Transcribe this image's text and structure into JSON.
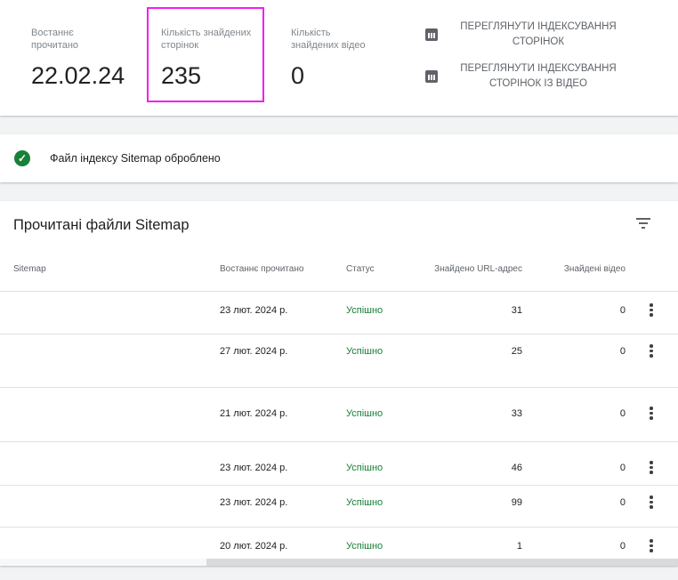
{
  "stats": [
    {
      "label": "Востаннє прочитано",
      "value": "22.02.24"
    },
    {
      "label": "Кількість знайдених сторінок",
      "value": "235"
    },
    {
      "label": "Кількість знайдених відео",
      "value": "0"
    }
  ],
  "links": [
    "ПЕРЕГЛЯНУТИ ІНДЕКСУВАННЯ СТОРІНОК",
    "ПЕРЕГЛЯНУТИ ІНДЕКСУВАННЯ СТОРІНОК ІЗ ВІДЕО"
  ],
  "status": "Файл індексу Sitemap оброблено",
  "table": {
    "title": "Прочитані файли Sitemap",
    "headers": [
      "Sitemap",
      "Востаннє прочитано",
      "Статус",
      "Знайдено URL-адрес",
      "Знайдені відео"
    ],
    "rows": [
      {
        "sitemap": "",
        "date": "23 лют. 2024 р.",
        "status": "Успішно",
        "urls": "31",
        "videos": "0"
      },
      {
        "sitemap": "",
        "date": "27 лют. 2024 р.",
        "status": "Успішно",
        "urls": "25",
        "videos": "0"
      },
      {
        "sitemap": "",
        "date": "21 лют. 2024 р.",
        "status": "Успішно",
        "urls": "33",
        "videos": "0"
      },
      {
        "sitemap": "",
        "date": "23 лют. 2024 р.",
        "status": "Успішно",
        "urls": "46",
        "videos": "0"
      },
      {
        "sitemap": "",
        "date": "23 лют. 2024 р.",
        "status": "Успішно",
        "urls": "99",
        "videos": "0"
      },
      {
        "sitemap": "",
        "date": "20 лют. 2024 р.",
        "status": "Успішно",
        "urls": "1",
        "videos": "0"
      }
    ]
  },
  "colors": {
    "success": "#188038",
    "highlight": "#f21ff2"
  }
}
